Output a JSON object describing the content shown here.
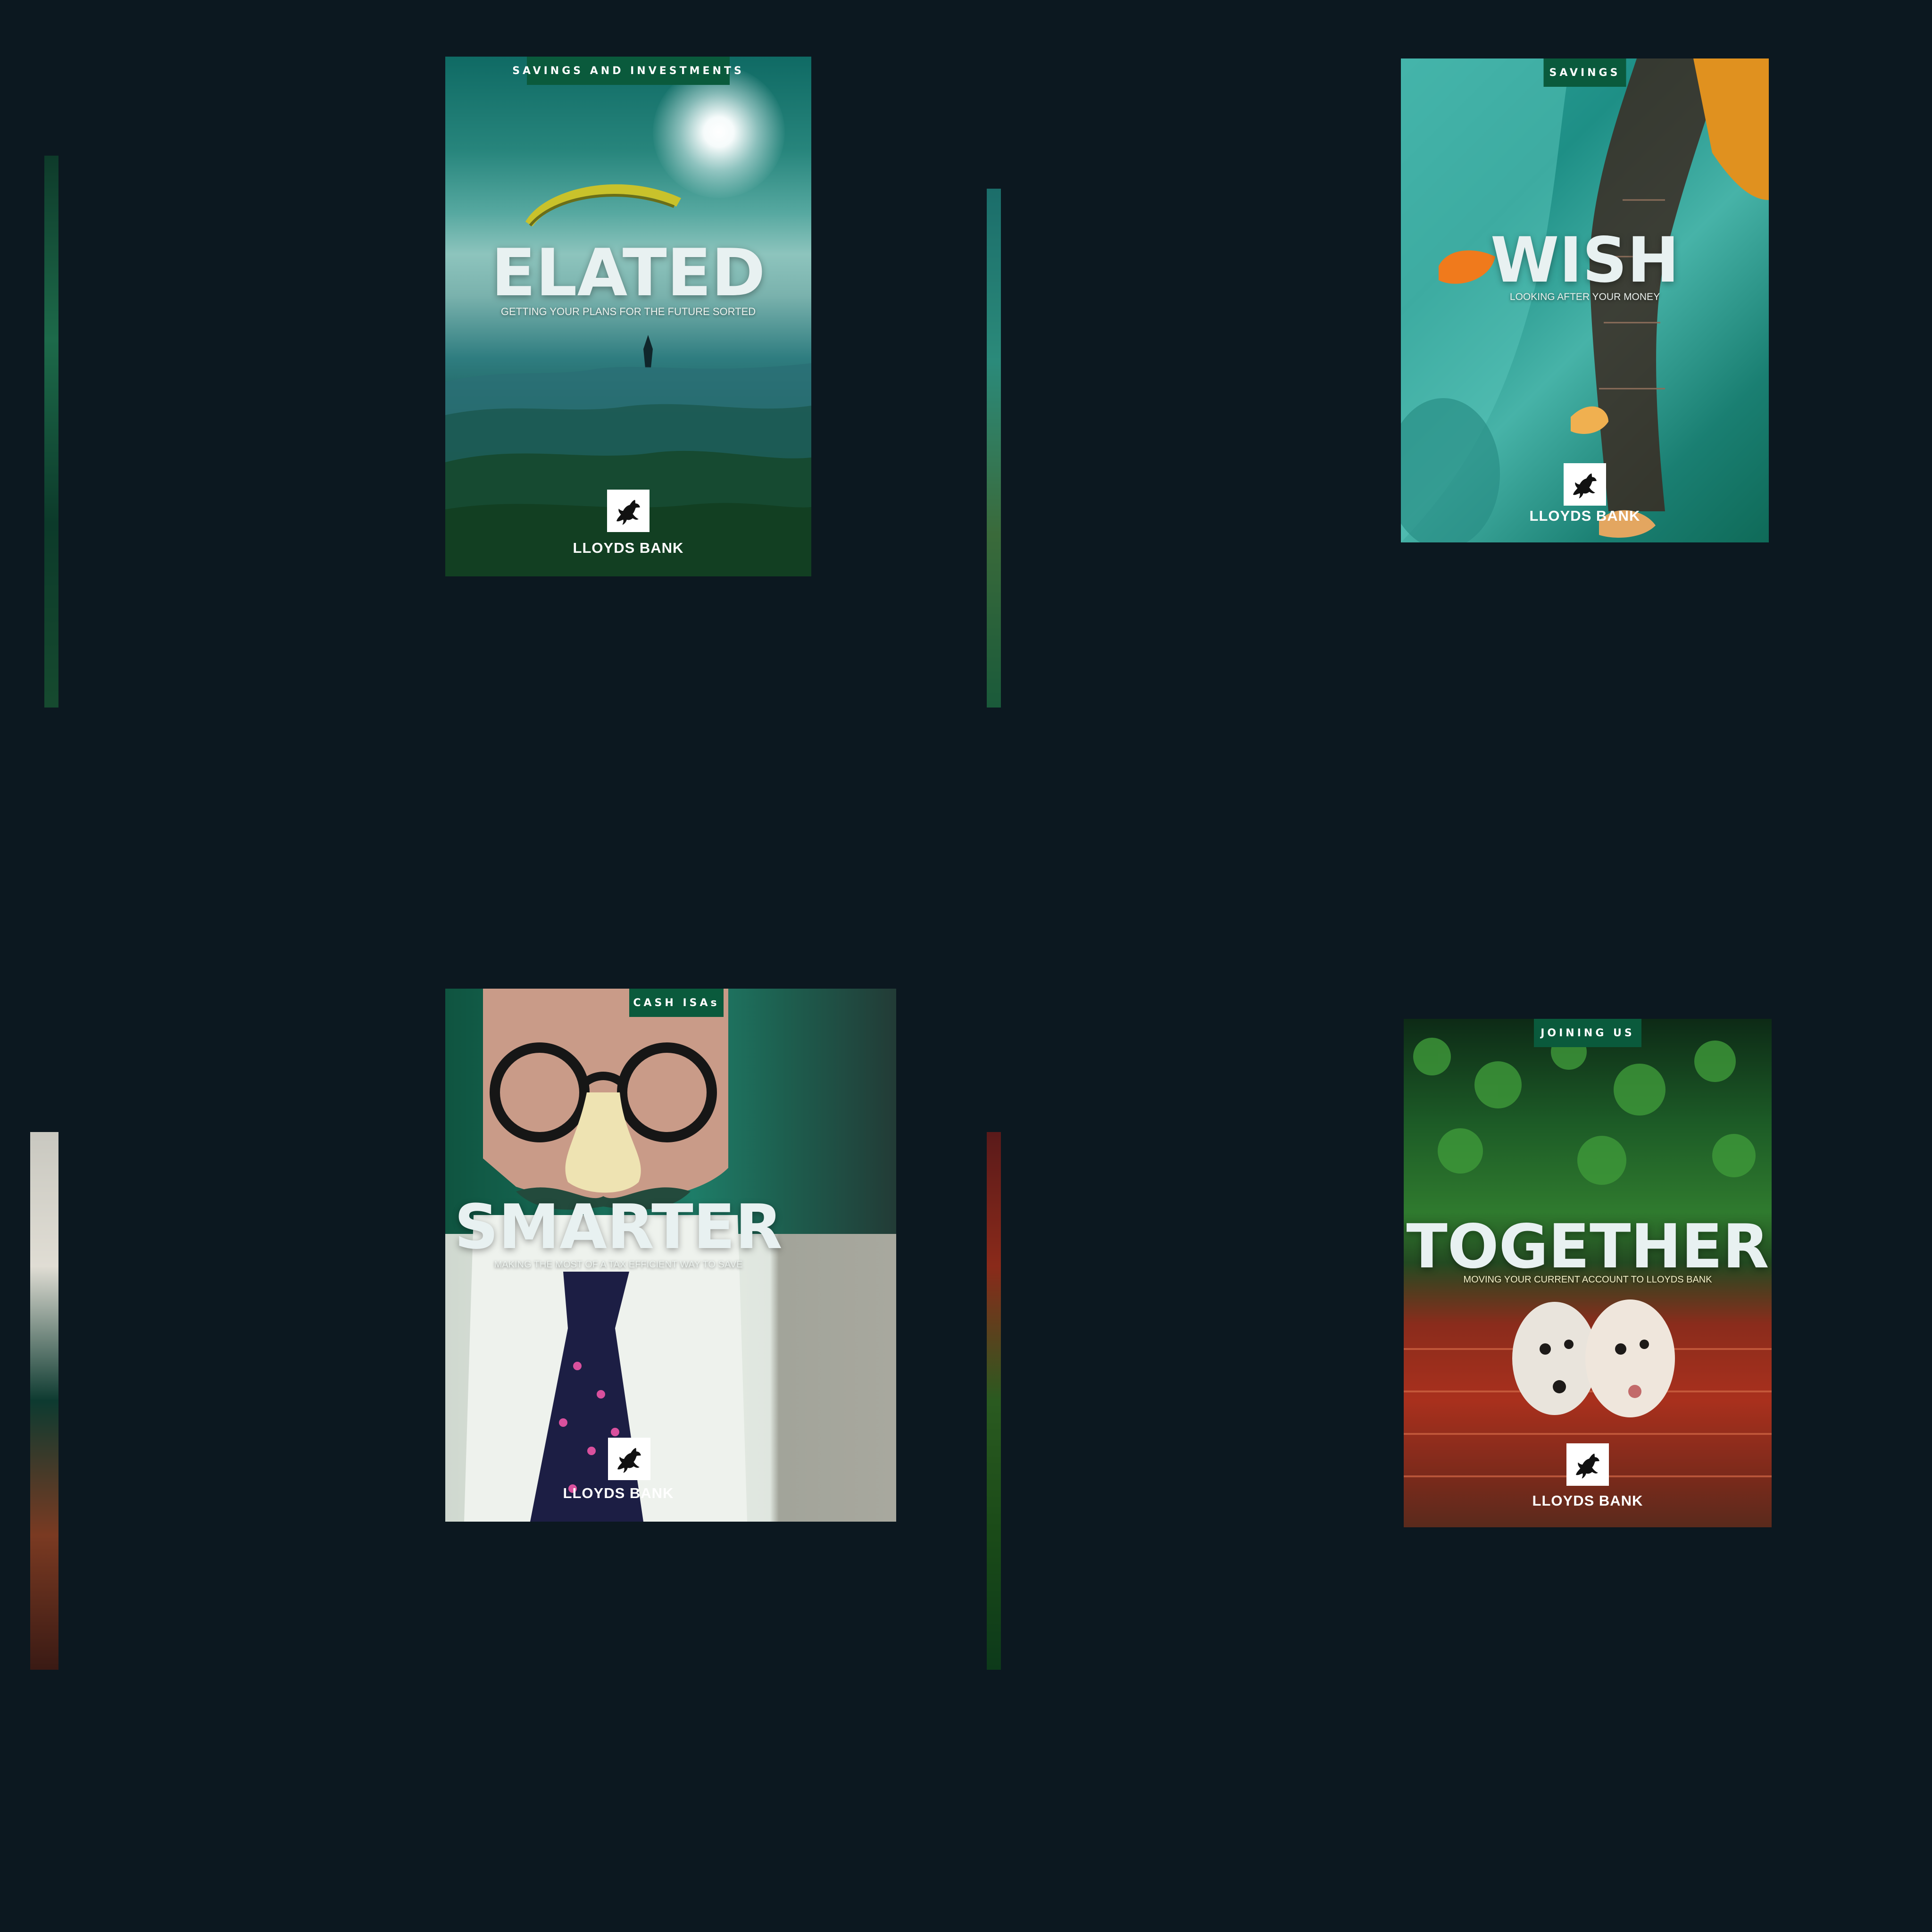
{
  "posters": {
    "elated": {
      "tag": "SAVINGS AND INVESTMENTS",
      "headline": "ELATED",
      "subline": "GETTING YOUR PLANS FOR THE FUTURE SORTED",
      "brand": "LLOYDS BANK",
      "logo_icon": "black-horse-icon"
    },
    "wish": {
      "tag": "SAVINGS",
      "headline": "WISH",
      "subline": "LOOKING AFTER YOUR MONEY",
      "brand": "LLOYDS BANK",
      "logo_icon": "black-horse-icon"
    },
    "smarter": {
      "tag": "CASH ISAs",
      "headline": "SMARTER",
      "subline": "MAKING THE MOST OF A TAX EFFICIENT WAY TO SAVE",
      "brand": "LLOYDS BANK",
      "logo_icon": "black-horse-icon"
    },
    "together": {
      "tag": "JOINING US",
      "headline": "TOGETHER",
      "subline": "MOVING YOUR CURRENT ACCOUNT TO LLOYDS BANK",
      "brand": "LLOYDS BANK",
      "logo_icon": "black-horse-icon"
    }
  },
  "colors": {
    "background": "#0c1820",
    "tag_green": "#0a5a3c",
    "text_light": "#e8f1f1"
  }
}
